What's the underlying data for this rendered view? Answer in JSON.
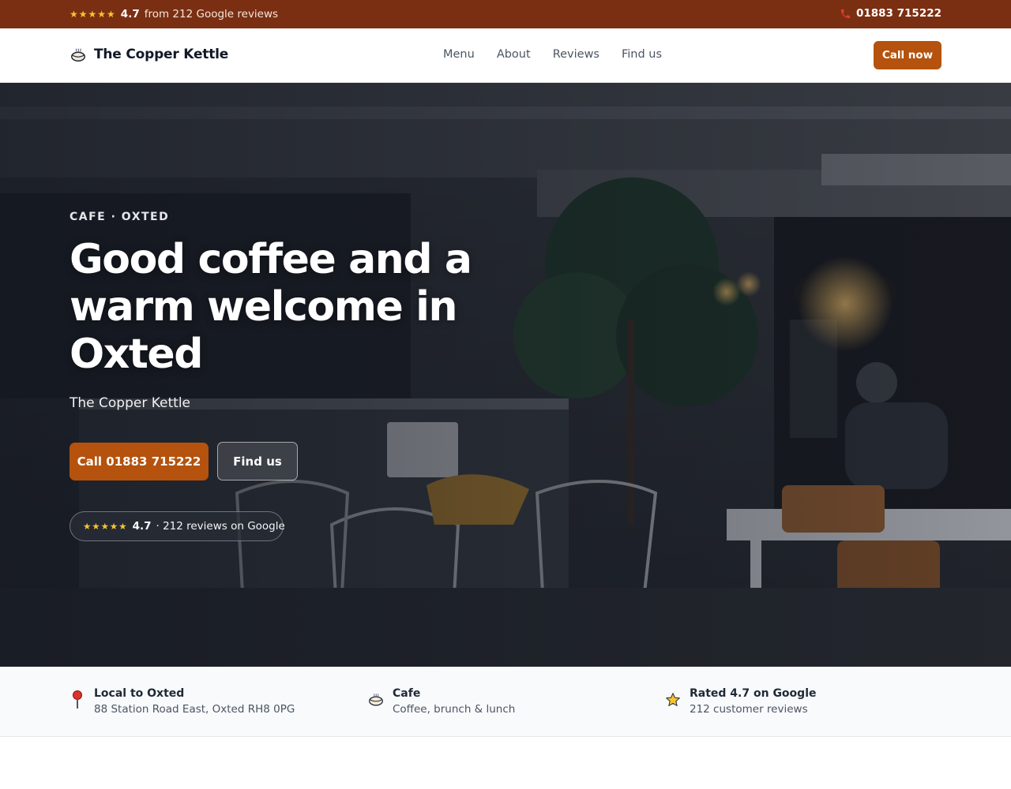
{
  "topbar": {
    "stars": "★★★★★",
    "rating": "4.7",
    "reviews_text": "from 212 Google reviews",
    "phone_icon": "phone-icon",
    "phone": "01883 715222"
  },
  "header": {
    "logo_icon": "kettle-logo-icon",
    "brand_name": "The Copper Kettle",
    "nav": [
      "Menu",
      "About",
      "Reviews",
      "Find us"
    ],
    "cta_label": "Call now"
  },
  "hero": {
    "eyebrow": "CAFE · OXTED",
    "title": "Good coffee and a warm welcome in Oxted",
    "subtitle": "The Copper Kettle",
    "primary_button": "Call 01883 715222",
    "secondary_button": "Find us",
    "review_stars": "★★★★★",
    "review_rating": "4.7",
    "review_text": "· 212 reviews on Google",
    "background": "cafe-interior-photo"
  },
  "features": [
    {
      "icon": "map-pin-icon",
      "title": "Local to Oxted",
      "desc": "88 Station Road East, Oxted RH8 0PG"
    },
    {
      "icon": "coffee-cup-icon",
      "title": "Cafe",
      "desc": "Coffee, brunch & lunch"
    },
    {
      "icon": "star-icon",
      "title": "Rated 4.7 on Google",
      "desc": "212 customer reviews"
    }
  ],
  "colors": {
    "topbar_bg": "#7b2f12",
    "accent": "#b5520d",
    "star": "#f5c531",
    "text_dark": "#111827"
  }
}
